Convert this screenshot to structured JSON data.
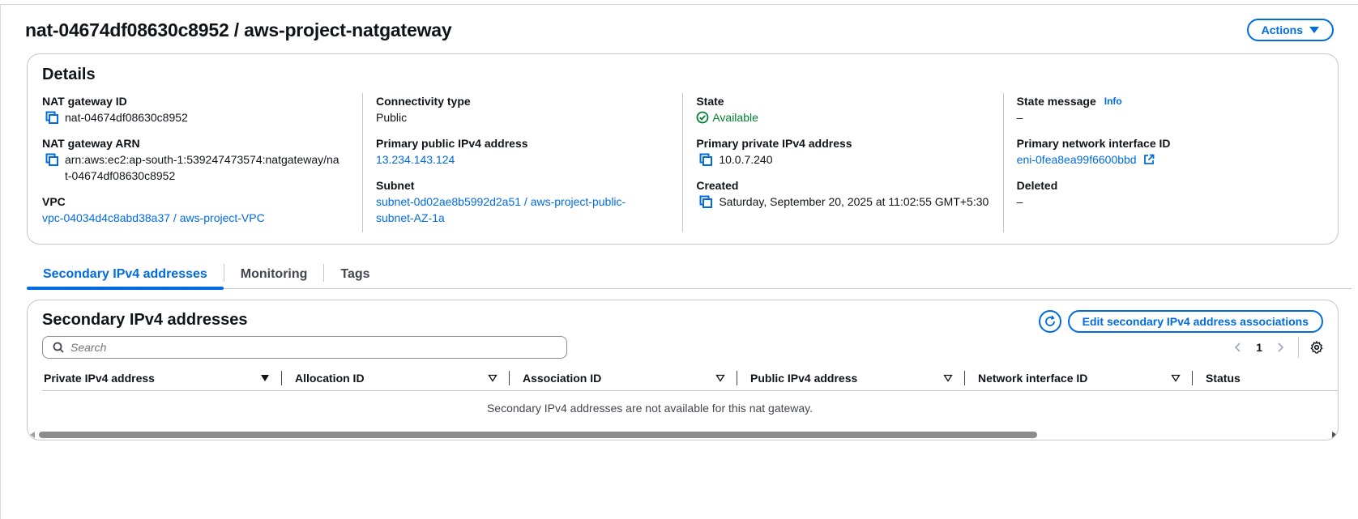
{
  "header": {
    "title": "nat-04674df08630c8952 / aws-project-natgateway",
    "actions_label": "Actions"
  },
  "details": {
    "title": "Details",
    "nat_gateway_id": {
      "label": "NAT gateway ID",
      "value": "nat-04674df08630c8952"
    },
    "nat_gateway_arn": {
      "label": "NAT gateway ARN",
      "value": "arn:aws:ec2:ap-south-1:539247473574:natgateway/nat-04674df08630c8952"
    },
    "vpc": {
      "label": "VPC",
      "value": "vpc-04034d4c8abd38a37 / aws-project-VPC"
    },
    "connectivity_type": {
      "label": "Connectivity type",
      "value": "Public"
    },
    "primary_public_ipv4": {
      "label": "Primary public IPv4 address",
      "value": "13.234.143.124"
    },
    "subnet": {
      "label": "Subnet",
      "value": "subnet-0d02ae8b5992d2a51 / aws-project-public-subnet-AZ-1a"
    },
    "state": {
      "label": "State",
      "value": "Available"
    },
    "primary_private_ipv4": {
      "label": "Primary private IPv4 address",
      "value": "10.0.7.240"
    },
    "created": {
      "label": "Created",
      "value": "Saturday, September 20, 2025 at 11:02:55 GMT+5:30"
    },
    "state_message": {
      "label": "State message",
      "info": "Info",
      "value": "–"
    },
    "primary_eni": {
      "label": "Primary network interface ID",
      "value": "eni-0fea8ea99f6600bbd"
    },
    "deleted": {
      "label": "Deleted",
      "value": "–"
    }
  },
  "tabs": [
    {
      "label": "Secondary IPv4 addresses",
      "active": true
    },
    {
      "label": "Monitoring",
      "active": false
    },
    {
      "label": "Tags",
      "active": false
    }
  ],
  "secondary": {
    "title": "Secondary IPv4 addresses",
    "edit_button": "Edit secondary IPv4 address associations",
    "search_placeholder": "Search",
    "page": "1",
    "columns": [
      "Private IPv4 address",
      "Allocation ID",
      "Association ID",
      "Public IPv4 address",
      "Network interface ID",
      "Status"
    ],
    "empty_message": "Secondary IPv4 addresses are not available for this nat gateway."
  },
  "colors": {
    "accent": "#006ce0",
    "success": "#00802f",
    "border": "#c6c6cd"
  },
  "icons": [
    "copy-icon",
    "check-circle-icon",
    "external-link-icon",
    "refresh-icon",
    "settings-icon",
    "search-icon",
    "chevron-left-icon",
    "chevron-right-icon",
    "sort-down-icon"
  ]
}
